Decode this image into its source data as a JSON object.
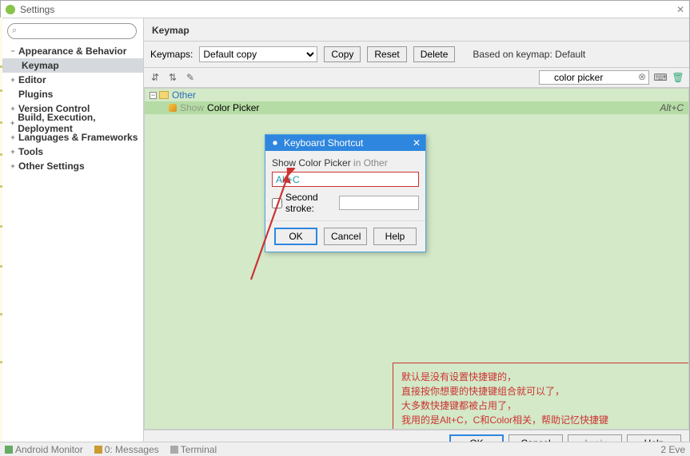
{
  "window": {
    "title": "Settings"
  },
  "sidebar": {
    "items": [
      {
        "label": "Appearance & Behavior",
        "bold": true,
        "exp": "−"
      },
      {
        "label": "Keymap",
        "child": true,
        "sel": true
      },
      {
        "label": "Editor",
        "bold": true,
        "exp": "+"
      },
      {
        "label": "Plugins",
        "bold": true
      },
      {
        "label": "Version Control",
        "bold": true,
        "exp": "+"
      },
      {
        "label": "Build, Execution, Deployment",
        "bold": true,
        "exp": "+"
      },
      {
        "label": "Languages & Frameworks",
        "bold": true,
        "exp": "+"
      },
      {
        "label": "Tools",
        "bold": true,
        "exp": "+"
      },
      {
        "label": "Other Settings",
        "bold": true,
        "exp": "+"
      }
    ]
  },
  "main": {
    "heading": "Keymap",
    "keymaps_label": "Keymaps:",
    "keymaps_value": "Default copy",
    "copy_btn": "Copy",
    "reset_btn": "Reset",
    "delete_btn": "Delete",
    "based_label": "Based on keymap:",
    "based_value": "Default",
    "filter_value": "color picker",
    "tree": {
      "root_label": "Other",
      "action_show": "Show",
      "action_label": "Color Picker",
      "shortcut": "Alt+C"
    }
  },
  "dialog": {
    "title": "Keyboard Shortcut",
    "desc_action": "Show Color Picker",
    "desc_in": " in Other",
    "stroke": "Alt+C",
    "second_label": "Second stroke:",
    "ok": "OK",
    "cancel": "Cancel",
    "help": "Help"
  },
  "annotation": {
    "l1": "默认是没有设置快捷键的，",
    "l2": "直接按你想要的快捷键组合就可以了，",
    "l3": "大多数快捷键都被占用了，",
    "l4": "我用的是Alt+C，C和Color相关，帮助记忆快捷键"
  },
  "footer": {
    "ok": "OK",
    "cancel": "Cancel",
    "apply": "Apply",
    "help": "Help"
  },
  "status": {
    "a": "Android Monitor",
    "b": "0: Messages",
    "c": "Terminal",
    "d": "2 Eve"
  }
}
